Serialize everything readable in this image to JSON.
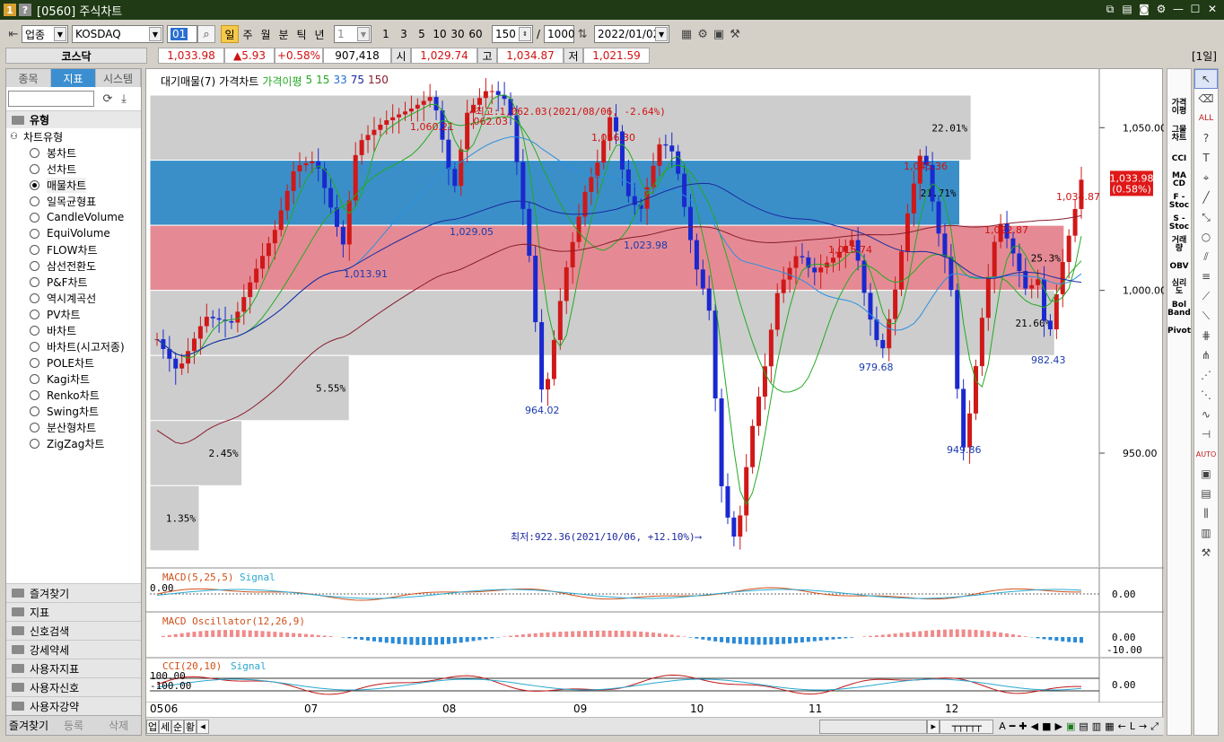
{
  "title": {
    "badge1": "1",
    "badge2": "?",
    "text": "[0560] 주식차트"
  },
  "toolbar": {
    "category": "업종",
    "market": "KOSDAQ",
    "code": "01",
    "periods": [
      "일",
      "주",
      "월",
      "분",
      "틱",
      "년"
    ],
    "active_period": "일",
    "interval_select": "1",
    "intervals": [
      "1",
      "3",
      "5",
      "10",
      "30",
      "60"
    ],
    "count": "150",
    "slash": "/",
    "total": "1000",
    "date": "2022/01/02"
  },
  "quote": {
    "name": "코스닥",
    "price": "1,033.98",
    "change": "▲5.93",
    "change_pct": "+0.58%",
    "volume": "907,418",
    "open_label": "시",
    "open": "1,029.74",
    "high_label": "고",
    "high": "1,034.87",
    "low_label": "저",
    "low": "1,021.59",
    "period_tag": "[1일]"
  },
  "left": {
    "tabs": [
      "종목",
      "지표",
      "시스템"
    ],
    "active_tab": "지표",
    "section": "유형",
    "node": "차트유형",
    "items": [
      "봉차트",
      "선차트",
      "매물차트",
      "일목균형표",
      "CandleVolume",
      "EquiVolume",
      "FLOW차트",
      "삼선전환도",
      "P&F차트",
      "역시계곡선",
      "PV차트",
      "바차트",
      "바차트(시고저종)",
      "POLE차트",
      "Kagi차트",
      "Renko차트",
      "Swing차트",
      "분산형차트",
      "ZigZag차트"
    ],
    "selected_item": "매물차트",
    "sections": [
      "즐겨찾기",
      "지표",
      "신호검색",
      "강세약세",
      "사용자지표",
      "사용자신호",
      "사용자강약"
    ],
    "footer": [
      "즐겨찾기",
      "등록",
      "삭제"
    ]
  },
  "chart": {
    "legend": [
      "대기매물(7)",
      "가격차트",
      "가격이평",
      "5",
      "15",
      "33",
      "75",
      "150"
    ],
    "legend_colors": [
      "#000000",
      "#000000",
      "#22aa22",
      "#22aa22",
      "#22aa22",
      "#1f6fd0",
      "#1a2aa0",
      "#8a1c2c"
    ],
    "max_note": "←최고:1,062.03(2021/08/06, -2.64%)",
    "min_note": "최저:922.36(2021/10/06, +12.10%)⟶",
    "price_labels": [
      {
        "text": "1,060.21",
        "color": "#d01010"
      },
      {
        "text": "1,062.03",
        "color": "#d01010"
      },
      {
        "text": "1,056.30",
        "color": "#d01010"
      },
      {
        "text": "1,045.36",
        "color": "#d01010"
      },
      {
        "text": "1,034.87",
        "color": "#d01010"
      },
      {
        "text": "1,022.87",
        "color": "#d01010"
      },
      {
        "text": "1,015.74",
        "color": "#d01010"
      },
      {
        "text": "1,029.05",
        "color": "#1a3ab0"
      },
      {
        "text": "1,023.98",
        "color": "#1a3ab0"
      },
      {
        "text": "1,013.91",
        "color": "#1a3ab0"
      },
      {
        "text": "964.02",
        "color": "#1a3ab0"
      },
      {
        "text": "979.68",
        "color": "#1a3ab0"
      },
      {
        "text": "982.43",
        "color": "#1a3ab0"
      },
      {
        "text": "949.86",
        "color": "#1a3ab0"
      }
    ],
    "volume_profile_pct": [
      "22.01%",
      "21.71%",
      "25.3%",
      "21.60%",
      "5.55%",
      "2.45%",
      "1.35%"
    ],
    "yticks": [
      "1,050.00",
      "1,000.00",
      "950.00"
    ],
    "current_price": "1,033.98",
    "current_pct": "(0.58%)",
    "xticks": [
      "05",
      "06",
      "07",
      "08",
      "09",
      "10",
      "11",
      "12"
    ],
    "macd_label": "MACD(5,25,5)",
    "macd_signal": "Signal",
    "macd_zero": "0.00",
    "macd_axis": "0.00",
    "osc_label": "MACD Oscillator(12,26,9)",
    "osc_axis_top": "0.00",
    "osc_axis_bottom": "-10.00",
    "cci_label": "CCI(20,10)",
    "cci_signal": "Signal",
    "cci_top": "100.00",
    "cci_bottom": "-100.00",
    "cci_axis": "0.00",
    "bottom_tabs": [
      "업",
      "세",
      "순",
      "황"
    ]
  },
  "rightbar": [
    "가격\n이평",
    "그물\n차트",
    "CCI",
    "MA\nCD",
    "F -\nStoc",
    "S -\nStoc",
    "거래\n량",
    "OBV",
    "심리\n도",
    "Bol\nBand",
    "Pivot"
  ],
  "chart_data": {
    "type": "candlestick",
    "title": "",
    "xlabel": "",
    "ylabel": "",
    "ylim": [
      915,
      1068
    ],
    "x_months": [
      "05",
      "06",
      "07",
      "08",
      "09",
      "10",
      "11",
      "12"
    ],
    "annotated_points": [
      {
        "label": "1,060.21",
        "value": 1060.21
      },
      {
        "label": "1,062.03",
        "value": 1062.03
      },
      {
        "label": "1,056.30",
        "value": 1056.3
      },
      {
        "label": "1,045.36",
        "value": 1045.36
      },
      {
        "label": "1,034.87",
        "value": 1034.87
      },
      {
        "label": "1,022.87",
        "value": 1022.87
      },
      {
        "label": "1,015.74",
        "value": 1015.74
      },
      {
        "label": "1,029.05",
        "value": 1029.05
      },
      {
        "label": "1,023.98",
        "value": 1023.98
      },
      {
        "label": "1,013.91",
        "value": 1013.91
      },
      {
        "label": "964.02",
        "value": 964.02
      },
      {
        "label": "979.68",
        "value": 979.68
      },
      {
        "label": "982.43",
        "value": 982.43
      },
      {
        "label": "949.86",
        "value": 949.86
      }
    ],
    "max": {
      "value": 1062.03,
      "date": "2021/08/06"
    },
    "min": {
      "value": 922.36,
      "date": "2021/10/06"
    },
    "last_close": 1033.98,
    "volume_profile": [
      {
        "low": 1040,
        "high": 1060,
        "pct": 22.01
      },
      {
        "low": 1020,
        "high": 1040,
        "pct": 21.71
      },
      {
        "low": 1000,
        "high": 1020,
        "pct": 25.3
      },
      {
        "low": 980,
        "high": 1000,
        "pct": 21.6
      },
      {
        "low": 960,
        "high": 980,
        "pct": 5.55
      },
      {
        "low": 940,
        "high": 960,
        "pct": 2.45
      },
      {
        "low": 920,
        "high": 940,
        "pct": 1.35
      }
    ]
  }
}
